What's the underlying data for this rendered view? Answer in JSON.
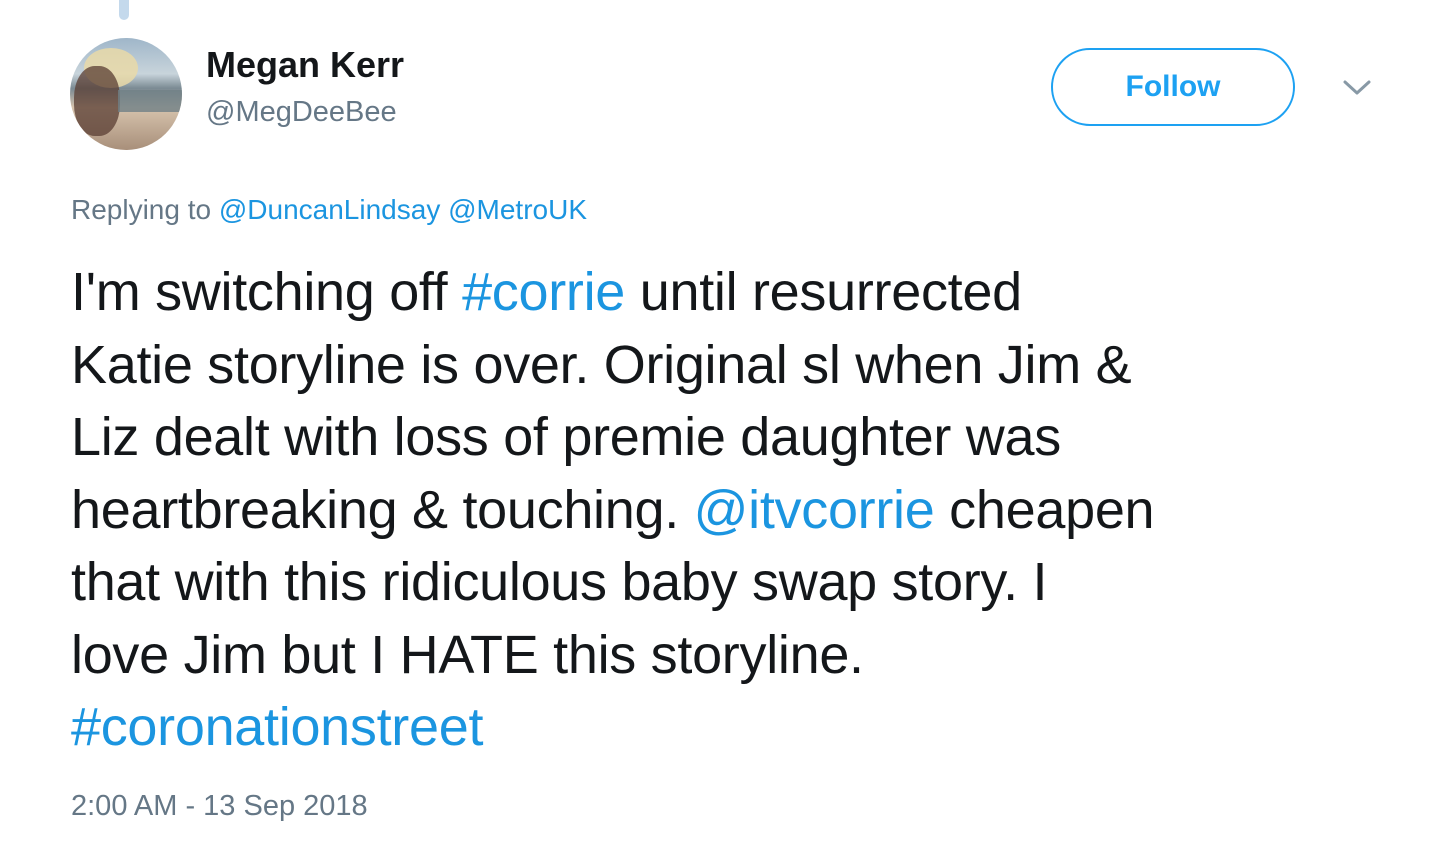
{
  "user": {
    "display_name": "Megan Kerr",
    "handle": "@MegDeeBee",
    "avatar_icon": "profile-photo-beach"
  },
  "actions": {
    "follow_label": "Follow",
    "more_icon": "chevron-down-icon"
  },
  "reply": {
    "prefix": "Replying to",
    "mentions": [
      "@DuncanLindsay",
      "@MetroUK"
    ]
  },
  "tweet": {
    "lines": [
      [
        {
          "text": "I'm switching off ",
          "link": false
        },
        {
          "text": "#corrie",
          "link": true
        },
        {
          "text": " until resurrected",
          "link": false
        }
      ],
      [
        {
          "text": "Katie storyline is over. Original sl when Jim &",
          "link": false
        }
      ],
      [
        {
          "text": "Liz dealt with loss of premie daughter was",
          "link": false
        }
      ],
      [
        {
          "text": "heartbreaking & touching. ",
          "link": false
        },
        {
          "text": "@itvcorrie",
          "link": true
        },
        {
          "text": " cheapen",
          "link": false
        }
      ],
      [
        {
          "text": "that with this ridiculous baby swap story. I",
          "link": false
        }
      ],
      [
        {
          "text": "love Jim but I HATE this storyline.",
          "link": false
        }
      ],
      [
        {
          "text": "#coronationstreet",
          "link": true
        }
      ]
    ]
  },
  "timestamp": "2:00 AM - 13 Sep 2018",
  "colors": {
    "link": "#1b95e0",
    "accent": "#1da1f2",
    "secondary_text": "#657786",
    "primary_text": "#14171a"
  }
}
